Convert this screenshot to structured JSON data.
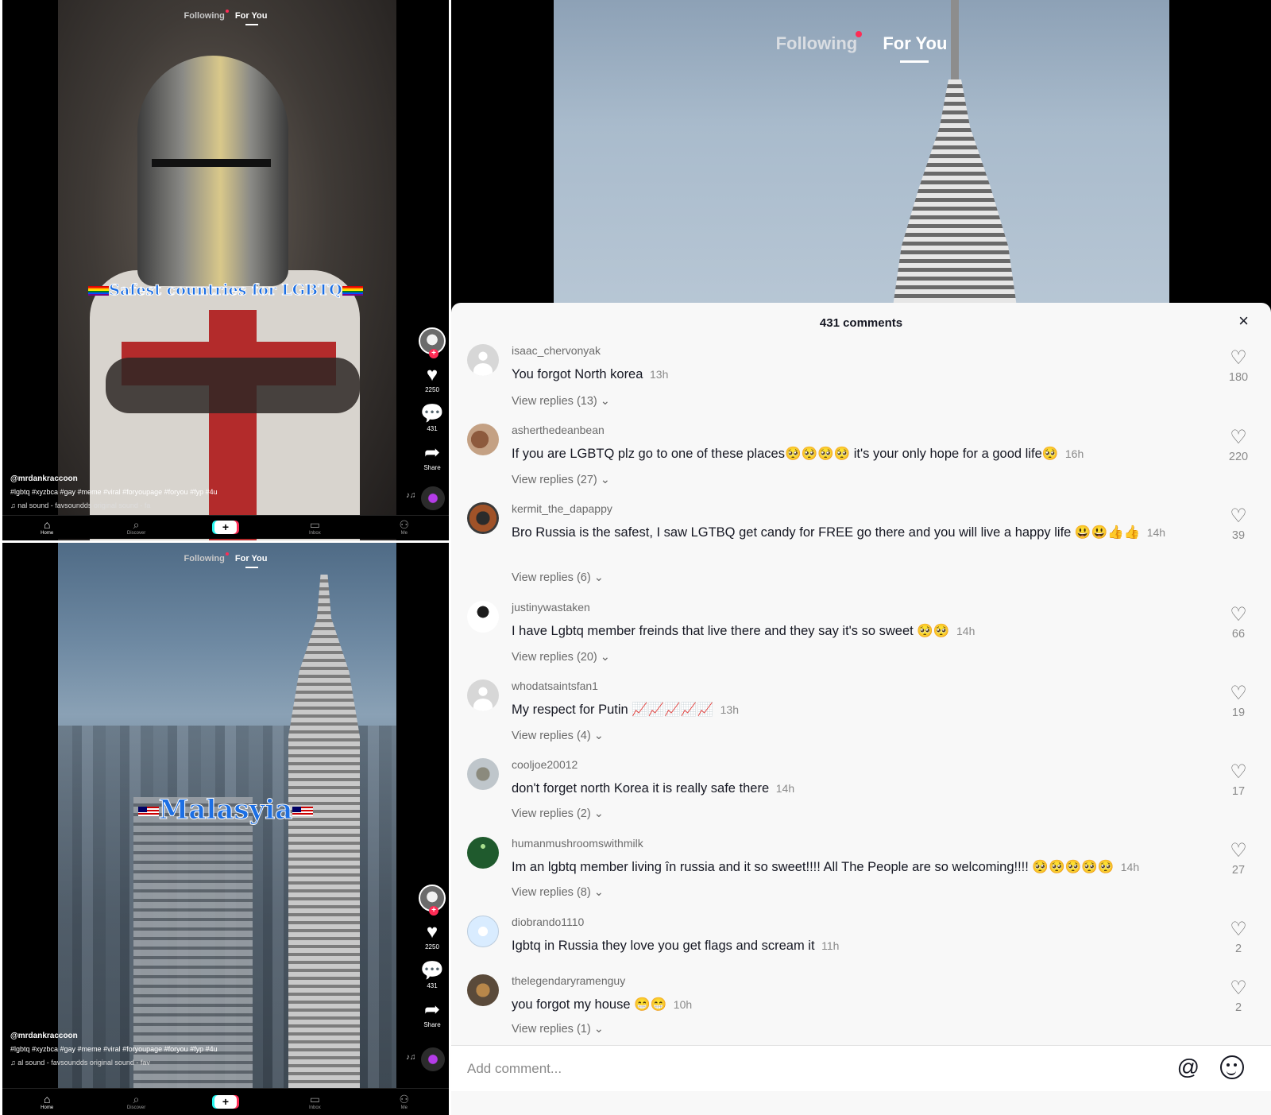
{
  "feed_tabs": {
    "following": "Following",
    "for_you": "For You"
  },
  "top_video": {
    "caption": "Safest countries for LGBTQ",
    "likes": "2250",
    "comments": "431",
    "share": "Share",
    "username": "@mrdankraccoon",
    "hashtags": "#lgbtq #xyzbca #gay #meme #viral #foryoupage #foryou #fyp #4u",
    "sound": "nal sound - favsoundds    original sound - fa"
  },
  "bottom_video": {
    "caption": "Malasyia",
    "likes": "2250",
    "comments": "431",
    "share": "Share",
    "username": "@mrdankraccoon",
    "hashtags": "#lgbtq #xyzbca #gay #meme #viral #foryoupage #foryou #fyp #4u",
    "sound": "al sound - favsoundds    original sound - fav"
  },
  "nav": {
    "home": "Home",
    "discover": "Discover",
    "create": "+",
    "inbox": "Inbox",
    "me": "Me"
  },
  "comments_panel": {
    "title": "431 comments",
    "close": "×",
    "add_placeholder": "Add comment...",
    "comments": [
      {
        "user": "isaac_chervonyak",
        "text": "You forgot North korea",
        "time": "13h",
        "replies": "View replies (13) ⌄",
        "likes": "180"
      },
      {
        "user": "asherthedeanbean",
        "text": "If you are LGBTQ plz go to one of these places🥺🥺🥺🥺 it's your only hope for a good life🥺",
        "time": "16h",
        "replies": "View replies (27) ⌄",
        "likes": "220"
      },
      {
        "user": "kermit_the_dapappy",
        "text": "Bro Russia is the safest, I saw LGTBQ get candy for FREE go there and you will live a happy life 😃😃👍👍",
        "time": "14h",
        "replies": "View replies (6) ⌄",
        "likes": "39"
      },
      {
        "user": "justinywastaken",
        "text": "I have Lgbtq member freinds that live there and they say it's so sweet 🥺🥺",
        "time": "14h",
        "replies": "View replies (20) ⌄",
        "likes": "66"
      },
      {
        "user": "whodatsaintsfan1",
        "text": "My respect for Putin 📈📈📈📈📈",
        "time": "13h",
        "replies": "View replies (4) ⌄",
        "likes": "19"
      },
      {
        "user": "cooljoe20012",
        "text": "don't forget north Korea it is really safe there",
        "time": "14h",
        "replies": "View replies (2) ⌄",
        "likes": "17"
      },
      {
        "user": "humanmushroomswithmilk",
        "text": "Im an lgbtq member living în russia and it so sweet!!!! All The People are so welcoming!!!! 🥺🥺🥺🥺🥺",
        "time": "14h",
        "replies": "View replies (8) ⌄",
        "likes": "27"
      },
      {
        "user": "diobrando1110",
        "text": "Igbtq in Russia they love you get flags and scream it",
        "time": "11h",
        "replies": "",
        "likes": "2"
      },
      {
        "user": "thelegendaryramenguy",
        "text": "you forgot my house 😁😁",
        "time": "10h",
        "replies": "View replies (1) ⌄",
        "likes": "2"
      }
    ]
  },
  "icons": {
    "heart": "heart-icon",
    "comment": "comment-icon",
    "share": "share-icon",
    "at": "at-icon",
    "emoji": "emoji-icon",
    "close": "close-icon"
  },
  "colors": {
    "accent_red": "#fe2c55",
    "accent_cyan": "#25f4ee",
    "caption_blue": "#1c6fe4"
  }
}
